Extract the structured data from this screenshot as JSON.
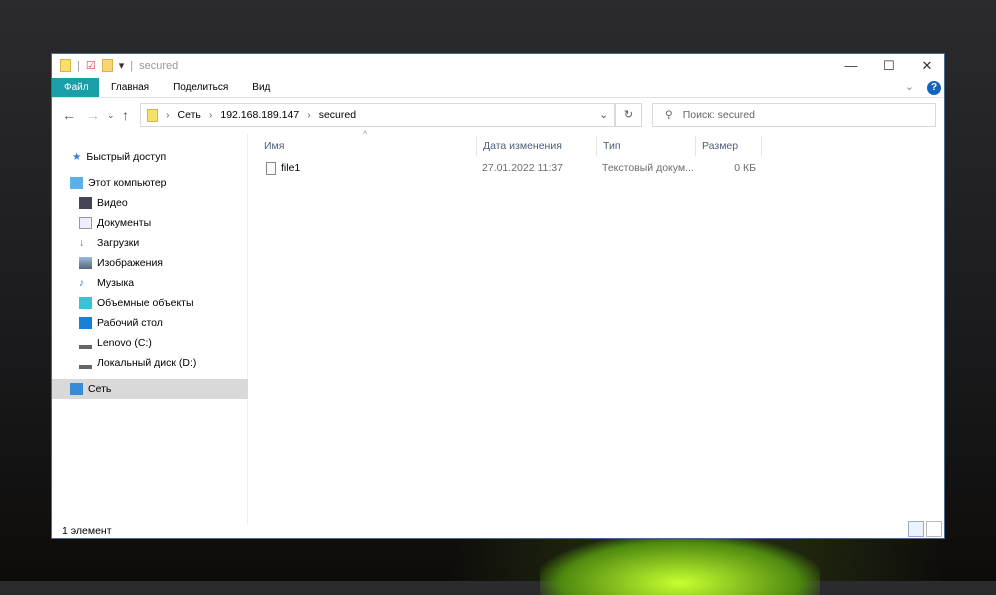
{
  "title": "secured",
  "ribbon": {
    "tabs": [
      "Файл",
      "Главная",
      "Поделиться",
      "Вид"
    ]
  },
  "address": {
    "segments": [
      "Сеть",
      "192.168.189.147",
      "secured"
    ],
    "search_placeholder": "Поиск: secured"
  },
  "sidebar": {
    "items": [
      "Быстрый доступ",
      "Этот компьютер",
      "Видео",
      "Документы",
      "Загрузки",
      "Изображения",
      "Музыка",
      "Объемные объекты",
      "Рабочий стол",
      "Lenovo (C:)",
      "Локальный диск (D:)",
      "Сеть"
    ]
  },
  "columns": [
    "Имя",
    "Дата изменения",
    "Тип",
    "Размер"
  ],
  "files": [
    {
      "name": "file1",
      "date": "27.01.2022 11:37",
      "type": "Текстовый докум...",
      "size": "0 КБ"
    }
  ],
  "status": "1 элемент",
  "colors": {
    "file_tab": "#1a9ea8",
    "selection": "#d9d9d9"
  }
}
